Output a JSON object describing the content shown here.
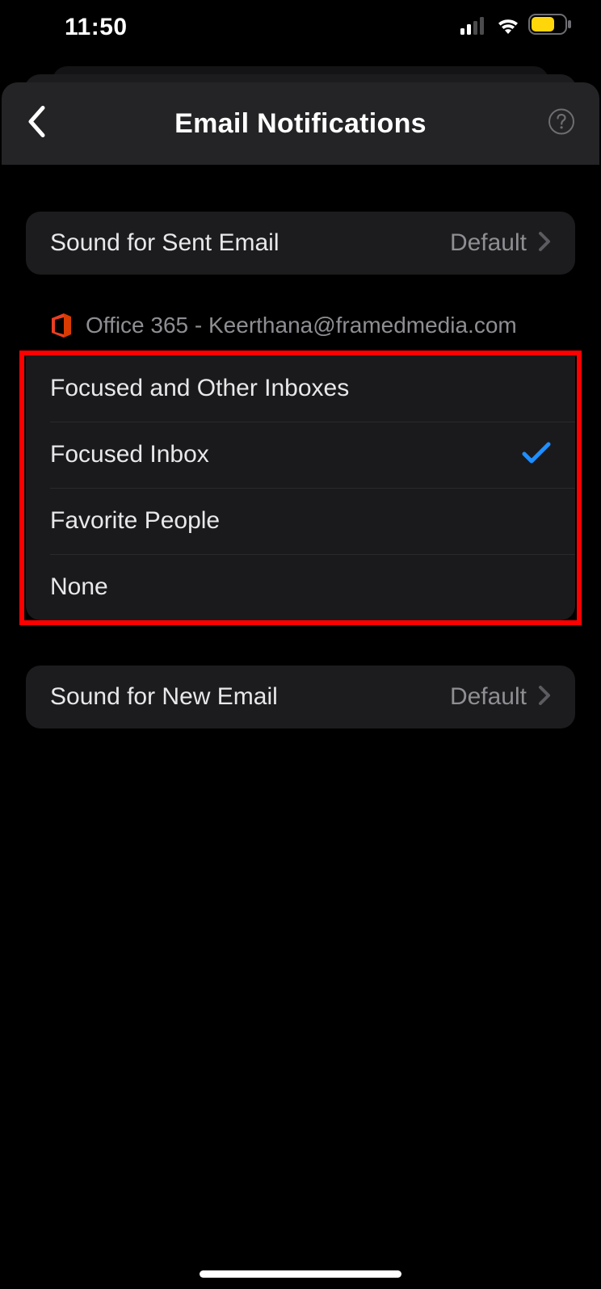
{
  "status": {
    "time": "11:50"
  },
  "header": {
    "title": "Email Notifications"
  },
  "sentSound": {
    "label": "Sound for Sent Email",
    "value": "Default"
  },
  "account": {
    "label": "Office 365 - Keerthana@framedmedia.com"
  },
  "options": [
    {
      "label": "Focused and Other Inboxes",
      "selected": false
    },
    {
      "label": "Focused Inbox",
      "selected": true
    },
    {
      "label": "Favorite People",
      "selected": false
    },
    {
      "label": "None",
      "selected": false
    }
  ],
  "newSound": {
    "label": "Sound for New Email",
    "value": "Default"
  }
}
